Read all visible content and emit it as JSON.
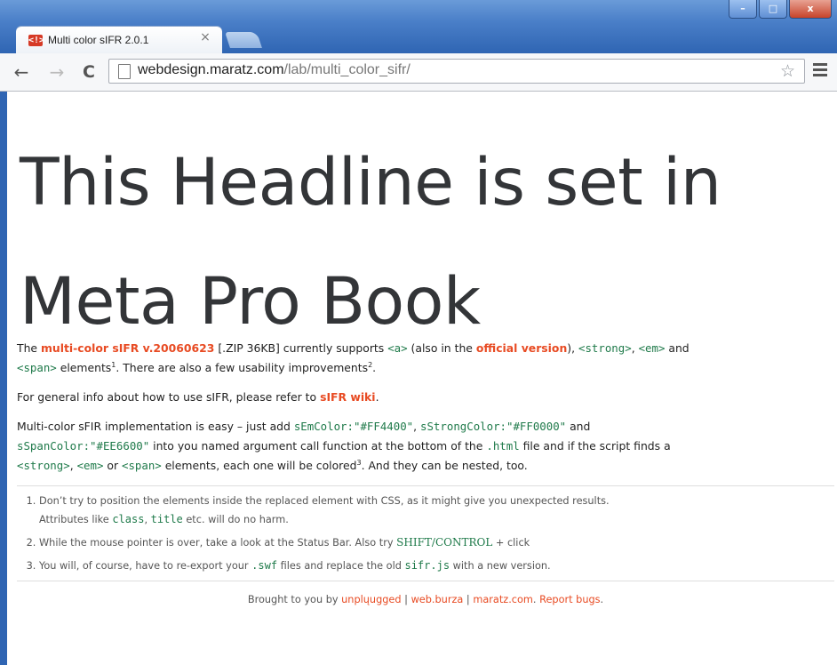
{
  "window": {
    "tab_title": "Multi color sIFR 2.0.1",
    "favicon_text": "<!>",
    "tab_close": "×",
    "controls": {
      "minimize": "–",
      "maximize": "□",
      "close": "x"
    }
  },
  "toolbar": {
    "back": "←",
    "forward": "→",
    "reload": "C",
    "url_host": "webdesign.maratz.com",
    "url_path": "/lab/multi_color_sifr/",
    "star": "☆"
  },
  "page": {
    "headline_line1": "This Headline is set in",
    "headline_line2": "Meta Pro Book",
    "p1": {
      "t1": "The ",
      "link1": "multi-color sIFR v.20060623",
      "t2": " [.ZIP 36KB] currently supports ",
      "c1": "<a>",
      "t3": " (also in the ",
      "link2": "official version",
      "t4": "), ",
      "c2": "<strong>",
      "t5": ", ",
      "c3": "<em>",
      "t6": " and ",
      "c4": "<span>",
      "t7": " elements",
      "s1": "1",
      "t8": ". There are also a few usability improvements",
      "s2": "2",
      "t9": "."
    },
    "p2": {
      "t1": "For general info about how to use sIFR, please refer to ",
      "link": "sIFR wiki",
      "t2": "."
    },
    "p3": {
      "t1": "Multi-color sFIR implementation is easy – just add ",
      "c1": "sEmColor:\"#FF4400\"",
      "t2": ", ",
      "c2": "sStrongColor:\"#FF0000\"",
      "t3": " and ",
      "c3": "sSpanColor:\"#EE6600\"",
      "t4": " into you named argument call function at the bottom of the ",
      "c4": ".html",
      "t5": " file and if the script finds a ",
      "c5": "<strong>",
      "t6": ", ",
      "c6": "<em>",
      "t7": " or ",
      "c7": "<span>",
      "t8": " elements, each one will be colored",
      "s1": "3",
      "t9": ". And they can be nested, too."
    },
    "notes": {
      "n1": {
        "t1": "Don’t try to position the elements inside the replaced element with CSS, as it might give you unexpected results.",
        "t2": "Attributes like ",
        "c1": "class",
        "t3": ", ",
        "c2": "title",
        "t4": " etc. will do no harm."
      },
      "n2": {
        "t1": "While the mouse pointer is over, take a look at the Status Bar. Also try ",
        "k1": "SHIFT/CONTROL",
        "t2": " + click"
      },
      "n3": {
        "t1": "You will, of course, have to re-export your ",
        "c1": ".swf",
        "t2": " files and replace the old ",
        "c2": "sifr.js",
        "t3": " with a new version."
      }
    },
    "footer": {
      "t1": "Brought to you by ",
      "l1": "unplųugged",
      "sep1": " | ",
      "l2": "web.burza",
      "sep2": " | ",
      "l3": "maratz.com",
      "t2": ". ",
      "l4": "Report bugs",
      "t3": "."
    }
  }
}
